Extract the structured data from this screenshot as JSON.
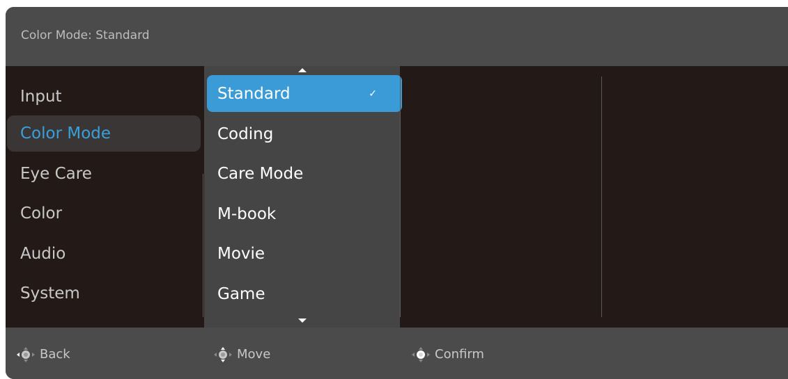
{
  "header": {
    "title": "Color Mode: Standard"
  },
  "sidebar": {
    "items": [
      {
        "label": "Input",
        "active": false
      },
      {
        "label": "Color Mode",
        "active": true
      },
      {
        "label": "Eye Care",
        "active": false
      },
      {
        "label": "Color",
        "active": false
      },
      {
        "label": "Audio",
        "active": false
      },
      {
        "label": "System",
        "active": false
      }
    ]
  },
  "submenu": {
    "items": [
      {
        "label": "Standard",
        "selected": true
      },
      {
        "label": "Coding",
        "selected": false
      },
      {
        "label": "Care Mode",
        "selected": false
      },
      {
        "label": "M-book",
        "selected": false
      },
      {
        "label": "Movie",
        "selected": false
      },
      {
        "label": "Game",
        "selected": false
      }
    ],
    "check_glyph": "✓",
    "icons": {
      "scroll_up": "triangle-up-icon",
      "scroll_down": "triangle-down-icon"
    }
  },
  "footer": {
    "hints": [
      {
        "label": "Back",
        "icon": "joystick-left-icon"
      },
      {
        "label": "Move",
        "icon": "joystick-updown-icon"
      },
      {
        "label": "Confirm",
        "icon": "joystick-press-icon"
      }
    ]
  },
  "colors": {
    "accent": "#3b9bd6",
    "active_text": "#39a0db",
    "background": "#231a18",
    "bar": "#4b4b4c",
    "submenu_bg": "#454546"
  }
}
